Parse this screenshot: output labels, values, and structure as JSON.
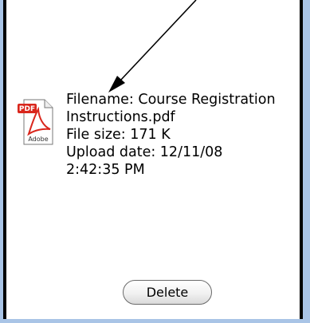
{
  "file": {
    "icon": "pdf-file-icon",
    "icon_badge": "PDF",
    "icon_brand": "Adobe",
    "filename_line1": "Filename: Course Registration",
    "filename_line2": "Instructions.pdf",
    "filesize": "File size: 171 K",
    "upload_date": "Upload date: 12/11/08",
    "upload_time": "2:42:35 PM"
  },
  "actions": {
    "delete_label": "Delete"
  },
  "colors": {
    "background": "#a9c4e6",
    "panel_border": "#000000",
    "pdf_red": "#d9261c"
  }
}
